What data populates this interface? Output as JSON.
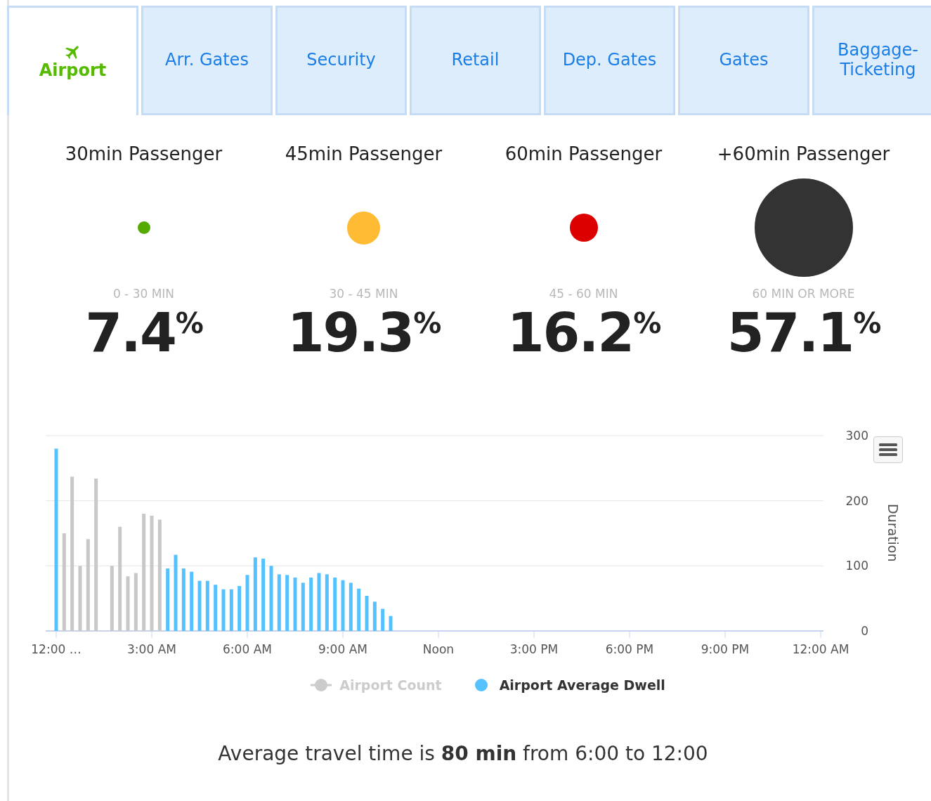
{
  "tabs": [
    {
      "label": "Airport",
      "selected": true
    },
    {
      "label": "Arr. Gates",
      "selected": false
    },
    {
      "label": "Security",
      "selected": false
    },
    {
      "label": "Retail",
      "selected": false
    },
    {
      "label": "Dep. Gates",
      "selected": false
    },
    {
      "label": "Gates",
      "selected": false
    },
    {
      "label": "Baggage-Ticketing",
      "selected": false
    }
  ],
  "stats": [
    {
      "title": "30min Passenger",
      "color": "#55aa00",
      "kind": "tiny",
      "range": "0 - 30 MIN",
      "value": "7.4$^{%}$"
    },
    {
      "title": "45min Passenger",
      "color": "#ffbb33",
      "kind": "medium",
      "range": "30 - 45 MIN",
      "value": "19.3$^{%}$"
    },
    {
      "title": "60min Passenger",
      "color": "#dd0000",
      "kind": "small",
      "range": "45 - 60 MIN",
      "value": "16.2$^{%}$"
    },
    {
      "title": "+60min Passenger",
      "color": "#333333",
      "kind": "huge",
      "range": "60 MIN OR MORE",
      "value": "57.1$^{%}$"
    }
  ],
  "chart": {
    "chart_data": {
      "type": "bar",
      "ylabel": "Duration",
      "x": [
        0,
        0.25,
        0.5,
        0.75,
        1,
        1.25,
        1.75,
        2,
        2.25,
        2.5,
        2.75,
        3,
        3.25,
        3.5,
        3.75,
        4,
        4.25,
        4.5,
        4.75,
        5,
        5.25,
        5.5,
        5.75,
        6,
        6.25,
        6.5,
        6.75,
        7,
        7.25,
        7.5,
        7.75,
        8,
        8.25,
        8.5,
        8.75,
        9,
        9.25,
        9.5,
        9.75,
        10,
        10.25,
        10.5
      ],
      "series": [
        {
          "name": "Airport Count",
          "color": "#c8c8c8",
          "values": [
            null,
            150,
            237,
            100,
            141,
            234,
            100,
            160,
            84,
            89,
            180,
            177,
            171,
            null,
            null,
            null,
            null,
            null,
            null,
            null,
            null,
            null,
            null,
            null,
            null,
            null,
            null,
            null,
            null,
            null,
            null,
            null,
            null,
            null,
            null,
            null,
            null,
            null,
            null,
            null,
            null,
            null
          ]
        },
        {
          "name": "Airport Average Dwell",
          "color": "#55c1ff",
          "values": [
            280,
            null,
            null,
            null,
            null,
            null,
            null,
            null,
            null,
            null,
            null,
            null,
            null,
            96,
            117,
            96,
            91,
            77,
            77,
            71,
            64,
            64,
            69,
            86,
            113,
            111,
            100,
            87,
            86,
            82,
            74,
            82,
            89,
            87,
            82,
            78,
            74,
            65,
            54,
            45,
            34,
            23
          ]
        }
      ],
      "xlim": [
        0,
        24
      ],
      "ylim": [
        0,
        300
      ],
      "xticks": [
        {
          "value": 0,
          "label": "12:00 …"
        },
        {
          "value": 3,
          "label": "3:00 AM"
        },
        {
          "value": 6,
          "label": "6:00 AM"
        },
        {
          "value": 9,
          "label": "9:00 AM"
        },
        {
          "value": 12,
          "label": "Noon"
        },
        {
          "value": 15,
          "label": "3:00 PM"
        },
        {
          "value": 18,
          "label": "6:00 PM"
        },
        {
          "value": 21,
          "label": "9:00 PM"
        },
        {
          "value": 24,
          "label": "12:00 AM"
        }
      ],
      "yticks": [
        0,
        100,
        200,
        300
      ]
    },
    "legend": [
      {
        "active": false
      },
      {
        "active": true
      }
    ]
  },
  "footer": "Average travel time is **80 min** from 6:00 to 12:00"
}
